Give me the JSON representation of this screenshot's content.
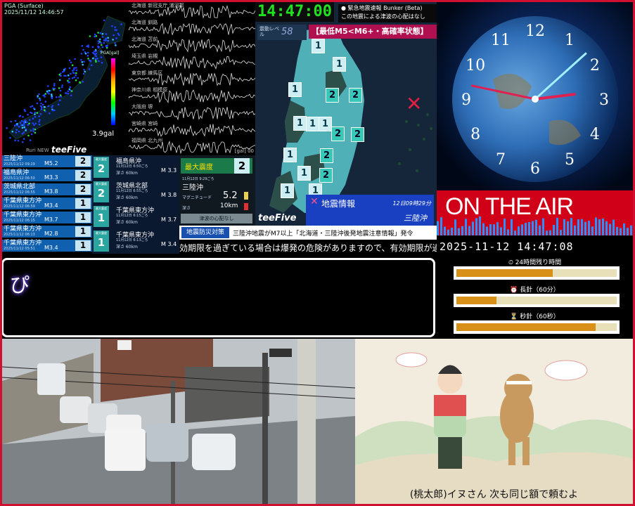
{
  "pga": {
    "header": "PGA (Surface)",
    "timestamp": "2025/11/12 14:46:57",
    "gal": "3.9gal",
    "logo": "teeFive",
    "brand2": "Ruri NEW",
    "scale_title": "PGA[gal]"
  },
  "waveform": {
    "stations": [
      "北海道 新冠支庁 浦河郡",
      "北海道 釧路",
      "北海道 苫前",
      "埼玉県 岩槻",
      "東京都 練馬区",
      "神奈川県 相模原",
      "大阪府 堺",
      "宮崎県 宮崎",
      "福岡県 北九州"
    ],
    "unit": "[gal] 00"
  },
  "tohoku": {
    "time": "14:47:00",
    "tsunami_line1": "● 緊急地震速報 Bunker (Beta)",
    "tsunami_line2": "この地震による津波の心配はなし",
    "level_label": "震動レベル",
    "level_value": "58",
    "probability": "【最低M5<M6+・高確率状態】",
    "epicenter_mark": "✕",
    "info_title": "地震情報",
    "info_time": "12日09時29分",
    "info_area": "三陸沖",
    "info_mark": "✕",
    "logo": "teeFive",
    "intensities": [
      "1",
      "1",
      "1",
      "1",
      "2",
      "2",
      "1",
      "1",
      "2",
      "2",
      "1",
      "2",
      "1",
      "2",
      "1",
      "1"
    ]
  },
  "clock": {
    "numbers": [
      "12",
      "1",
      "2",
      "3",
      "4",
      "5",
      "6",
      "7",
      "8",
      "9",
      "10",
      "11"
    ],
    "hour_hand_deg": 83,
    "minute_hand_deg": 282,
    "second_hand_deg": 48
  },
  "onair": {
    "label": "ON THE AIR",
    "datetime": "2025-11-12  14:47:08",
    "bars": [
      {
        "label": "⏲ 24時間残り時間",
        "fill": 0.6
      },
      {
        "label": "⏰ 長針（60分）",
        "fill": 0.25
      },
      {
        "label": "⏳ 秒針（60秒）",
        "fill": 0.87
      }
    ]
  },
  "intensity_list": [
    {
      "name": "三陸沖",
      "date": "2025/11/12 09:29",
      "mag": "M5.2",
      "shindo": "2",
      "color": "#c8e4f0"
    },
    {
      "name": "福島県沖",
      "date": "2025/11/12 06:50",
      "mag": "M3.3",
      "shindo": "2",
      "color": "#c8e4f0"
    },
    {
      "name": "茨城県北部",
      "date": "2025/11/12 06:55",
      "mag": "M3.8",
      "shindo": "2",
      "color": "#c8e4f0"
    },
    {
      "name": "千葉県東方沖",
      "date": "2025/11/12 06:59",
      "mag": "M3.4",
      "shindo": "1",
      "color": "#c8e4f0"
    },
    {
      "name": "千葉県東方沖",
      "date": "2025/11/12 06:15",
      "mag": "M3.7",
      "shindo": "1",
      "color": "#c8e4f0"
    },
    {
      "name": "千葉県東方沖",
      "date": "2025/11/12 06:13",
      "mag": "M2.8",
      "shindo": "1",
      "color": "#c8e4f0"
    },
    {
      "name": "千葉県東方沖",
      "date": "2025/11/12 05:51",
      "mag": "M3.4",
      "shindo": "1",
      "color": "#c8e4f0"
    }
  ],
  "detail": [
    {
      "title": "最大震度",
      "shindo": "2",
      "name": "福島県沖",
      "time": "11月12日 6:50ごろ",
      "depth": "深さ 60km",
      "mag": "M 3.3"
    },
    {
      "title": "最大震度",
      "shindo": "2",
      "name": "茨城県北部",
      "time": "11月12日 6:55ごろ",
      "depth": "深さ 60km",
      "mag": "M 3.8"
    },
    {
      "title": "最大震度",
      "shindo": "1",
      "name": "千葉県東方沖",
      "time": "11月12日 6:15ごろ",
      "depth": "深さ 60km",
      "mag": "M 3.7"
    },
    {
      "title": "最大震度",
      "shindo": "1",
      "name": "千葉県東方沖",
      "time": "11月12日 6:13ごろ",
      "depth": "深さ 60km",
      "mag": "M 3.4"
    }
  ],
  "max_panel": {
    "label": "最大震度",
    "value": "2",
    "time": "11月12日 9:29ごろ",
    "area": "三陸沖",
    "mag_label": "マグニチュード",
    "mag": "5.2",
    "depth_label": "深さ",
    "depth": "10km",
    "tsunami": "津波の心配なし"
  },
  "alert": {
    "tag": "地震防災対策",
    "message": "三陸沖地震がM7以上「北海道・三陸沖後発地震注意情報」発令"
  },
  "ticker": "効期限を過ぎている場合は爆発の危険がありますので、有効期限が過ぎた",
  "chat": "ぴ",
  "anime": {
    "subtitle": "(桃太郎)イヌさん 次も同じ額で頼むよ"
  }
}
